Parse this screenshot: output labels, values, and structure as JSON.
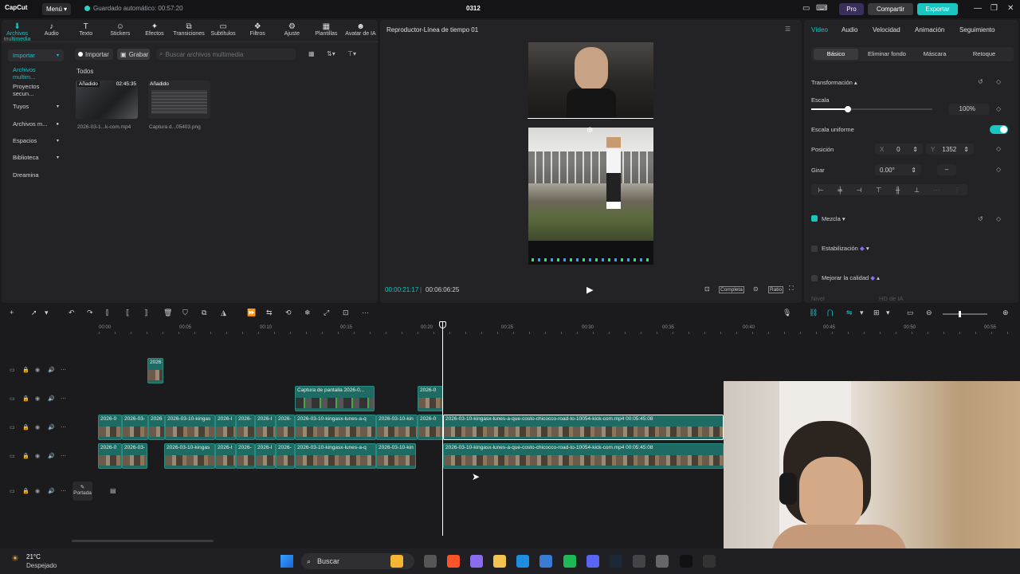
{
  "app": {
    "logo": "CapCut",
    "menu": "Menú",
    "autosave": "Guardado automático: 00:57:20",
    "title": "0312",
    "pro": "Pro",
    "share": "Compartir",
    "export": "Exportar"
  },
  "toolbar": [
    {
      "label": "Archivos multimedia",
      "icon": "media-icon"
    },
    {
      "label": "Audio",
      "icon": "audio-icon"
    },
    {
      "label": "Texto",
      "icon": "text-icon"
    },
    {
      "label": "Stickers",
      "icon": "sticker-icon"
    },
    {
      "label": "Efectos",
      "icon": "effects-icon"
    },
    {
      "label": "Transiciones",
      "icon": "transitions-icon"
    },
    {
      "label": "Subtítulos",
      "icon": "subtitles-icon"
    },
    {
      "label": "Filtros",
      "icon": "filters-icon"
    },
    {
      "label": "Ajuste",
      "icon": "adjust-icon"
    },
    {
      "label": "Plantillas",
      "icon": "templates-icon"
    },
    {
      "label": "Avatar de IA",
      "icon": "avatar-icon"
    }
  ],
  "sidebar": [
    {
      "label": "Importar"
    },
    {
      "label": "Archivos multim..."
    },
    {
      "label": "Proyectos secun..."
    },
    {
      "label": "Tuyos"
    },
    {
      "label": "Archivos m..."
    },
    {
      "label": "Espacios"
    },
    {
      "label": "Biblioteca"
    },
    {
      "label": "Dreamina"
    }
  ],
  "media": {
    "import_btn": "Importar",
    "record_btn": "Grabar",
    "search_placeholder": "Buscar archivos multimedia",
    "filter_label": "Todos",
    "items": [
      {
        "badge": "Añadido",
        "duration": "02:45:35",
        "name": "2026-03-1...k-com.mp4"
      },
      {
        "badge": "Añadido",
        "duration": "",
        "name": "Captura d...05403.png"
      }
    ]
  },
  "player": {
    "title": "Reproductor-Línea de tiempo 01",
    "current": "00:00:21:17",
    "total": "00:06:06:25",
    "complete": "Completa",
    "ratio": "Ratio"
  },
  "props": {
    "tabs": [
      "Vídeo",
      "Audio",
      "Velocidad",
      "Animación",
      "Seguimiento"
    ],
    "subtabs": [
      "Básico",
      "Eliminar fondo",
      "Máscara",
      "Retoque"
    ],
    "transform": "Transformación",
    "scale_label": "Escala",
    "scale_value": "100%",
    "scale_level": 0.3,
    "uniform_scale": "Escala uniforme",
    "position_label": "Posición",
    "pos_x_label": "X",
    "pos_x": "0",
    "pos_y_label": "Y",
    "pos_y": "1352",
    "rotate_label": "Girar",
    "rotate_value": "0.00°",
    "rotate_dash": "–",
    "blend": "Mezcla",
    "stabilize": "Estabilización",
    "enhance": "Mejorar la calidad",
    "level_label": "Nivel",
    "level_value": "HD de IA"
  },
  "ruler": [
    "00:00",
    "00:05",
    "00:10",
    "00:15",
    "00:20",
    "00:25",
    "00:30",
    "00:35",
    "00:40",
    "00:45",
    "00:50",
    "00:55"
  ],
  "tracks": {
    "clip_small": "2026",
    "clip_capture": "Captura de pantalla 2026-0...",
    "clip_small2": "2026-0",
    "main_labels": [
      "2026-0",
      "2026-03-",
      "2026",
      "2026-03-10-kingas",
      "2026-I",
      "2026-",
      "2026-I",
      "2026-",
      "2026-03-10-kingasx-lunes-a-q",
      "2026-03-10-kin",
      "2026-0"
    ],
    "main_long": "2026-03-10-kingasx-lunes-a-que-costo-chicocco-road-to-10054-kick-com.mp4  00:05:45:08",
    "lower_labels": [
      "2026-0",
      "2026-03-",
      "2026-03-10-kingas",
      "2026-I",
      "2026-",
      "2026-I",
      "2026-",
      "2026-03-10-kingasx-lunes-a-q",
      "2026-03-10-kin"
    ],
    "lower_long": "2026-03-10-kingasx-lunes-a-que-costo-chicocco-road-to-10054-kick-com.mp4  00:05:45:08",
    "cover": "Portada"
  },
  "taskbar": {
    "temp": "21°C",
    "weather": "Despejado",
    "search": "Buscar"
  }
}
